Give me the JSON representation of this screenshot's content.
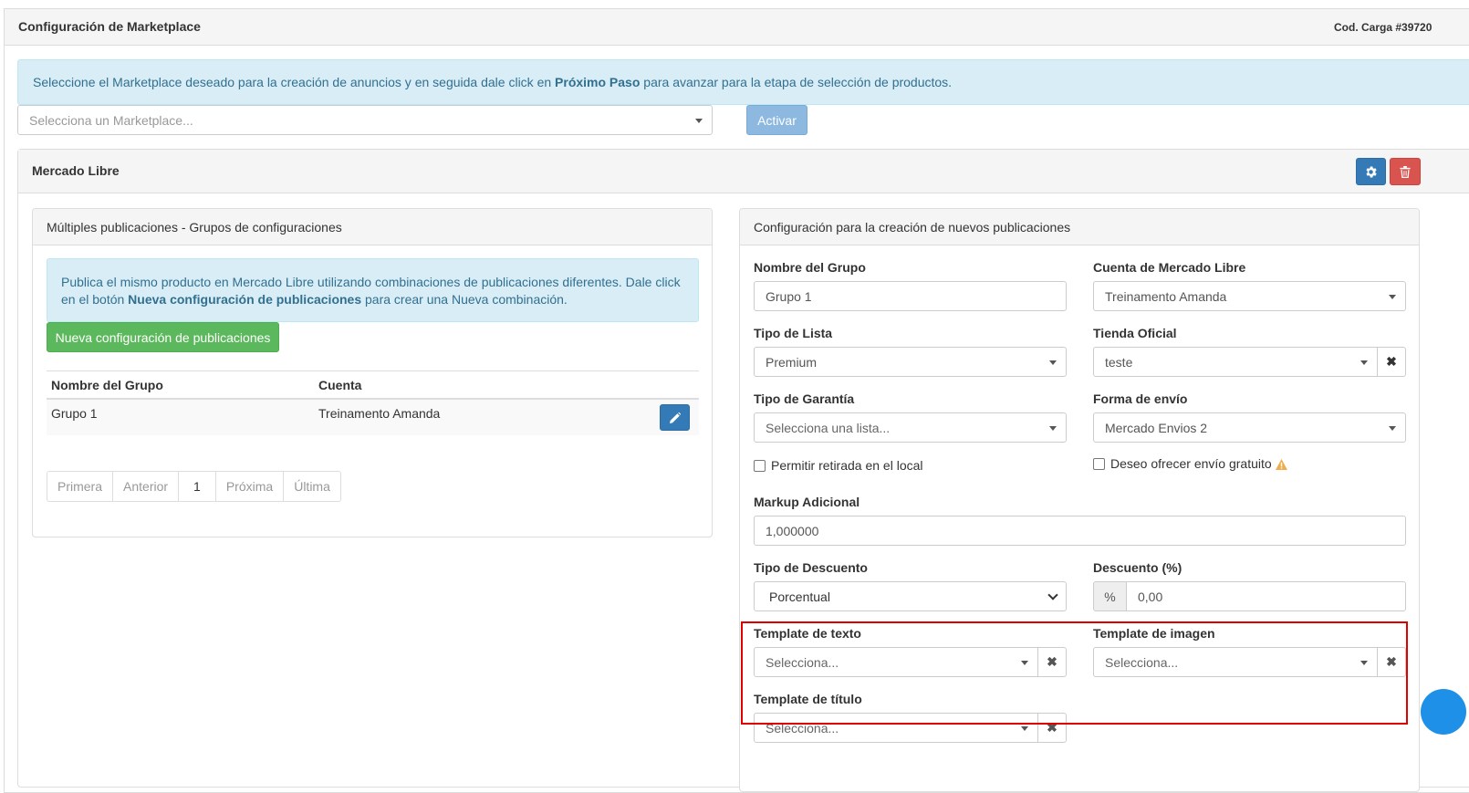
{
  "header": {
    "title": "Configuración de Marketplace",
    "code": "Cod. Carga #39720"
  },
  "intro": {
    "text_before": "Seleccione el Marketplace deseado para la creación de anuncios y en seguida dale click en ",
    "text_bold": "Próximo Paso",
    "text_after": " para avanzar para la etapa de selección de productos."
  },
  "marketplace_select": {
    "placeholder": "Selecciona un Marketplace..."
  },
  "activate_button": "Activar",
  "marketplace_panel": {
    "title": "Mercado Libre"
  },
  "groups_panel": {
    "title": "Múltiples publicaciones - Grupos de configuraciones",
    "info_before": "Publica el mismo producto en Mercado Libre utilizando combinaciones de publicaciones diferentes. Dale click en el botón ",
    "info_bold": "Nueva configuración de publicaciones",
    "info_after": " para crear una Nueva combinación.",
    "new_button": "Nueva configuración de publicaciones",
    "table": {
      "headers": [
        "Nombre del Grupo",
        "Cuenta"
      ],
      "rows": [
        [
          "Grupo 1",
          "Treinamento Amanda"
        ]
      ]
    },
    "pagination": [
      "Primera",
      "Anterior",
      "1",
      "Próxima",
      "Última"
    ]
  },
  "config_panel": {
    "title": "Configuración para la creación de nuevos publicaciones",
    "group_name": {
      "label": "Nombre del Grupo",
      "value": "Grupo 1"
    },
    "account": {
      "label": "Cuenta de Mercado Libre",
      "value": "Treinamento Amanda"
    },
    "list_type": {
      "label": "Tipo de Lista",
      "value": "Premium"
    },
    "store": {
      "label": "Tienda Oficial",
      "value": "teste"
    },
    "warranty": {
      "label": "Tipo de Garantía",
      "placeholder": "Selecciona una lista..."
    },
    "shipping": {
      "label": "Forma de envío",
      "value": "Mercado Envios 2"
    },
    "pickup_checkbox": "Permitir retirada en el local",
    "free_shipping_checkbox": "Deseo ofrecer envío gratuito",
    "markup": {
      "label": "Markup Adicional",
      "value": "1,000000"
    },
    "discount_type": {
      "label": "Tipo de Descuento",
      "value": "Porcentual"
    },
    "discount": {
      "label": "Descuento (%)",
      "addon": "%",
      "value": "0,00"
    },
    "text_template": {
      "label": "Template de texto",
      "placeholder": "Selecciona..."
    },
    "image_template": {
      "label": "Template de imagen",
      "placeholder": "Selecciona..."
    },
    "title_template": {
      "label": "Template de título",
      "placeholder": "Selecciona..."
    }
  },
  "colors": {
    "primary": "#337ab7",
    "danger": "#d9534f",
    "success": "#5cb85c",
    "info_bg": "#d9edf7",
    "highlight": "#e00000",
    "warning": "#f0ad4e"
  }
}
